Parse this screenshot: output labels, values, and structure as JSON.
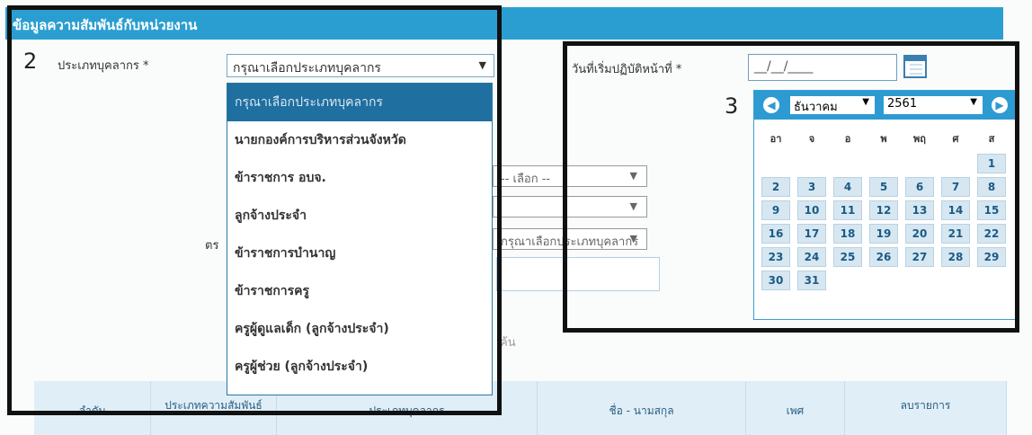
{
  "header": {
    "title": "ข้อมูลความสัมพันธ์กับหน่วยงาน"
  },
  "personnel": {
    "step": "2",
    "label": "ประเภทบุคลากร *",
    "select_value": "กรุณาเลือกประเภทบุคลากร",
    "options": [
      "กรุณาเลือกประเภทบุคลากร",
      "นายกองค์การบริหารส่วนจังหวัด",
      "ข้าราชการ อบจ.",
      "ลูกจ้างประจำ",
      "ข้าราชการบำนาญ",
      "ข้าราชการครู",
      "ครูผู้ดูแลเด็ก (ลูกจ้างประจำ)",
      "ครูผู้ช่วย (ลูกจ้างประจำ)"
    ]
  },
  "start_date": {
    "label": "วันที่เริ่มปฏิบัติหน้าที่ *",
    "placeholder": "__/__/____",
    "step": "3"
  },
  "calendar": {
    "month": "ธันวาคม",
    "year": "2561",
    "weekdays": [
      "อา",
      "จ",
      "อ",
      "พ",
      "พฤ",
      "ศ",
      "ส"
    ],
    "first_weekday_index": 6,
    "days": [
      "1",
      "2",
      "3",
      "4",
      "5",
      "6",
      "7",
      "8",
      "9",
      "10",
      "11",
      "12",
      "13",
      "14",
      "15",
      "16",
      "17",
      "18",
      "19",
      "20",
      "21",
      "22",
      "23",
      "24",
      "25",
      "26",
      "27",
      "28",
      "29",
      "30",
      "31"
    ]
  },
  "background": {
    "select1": "-- เลือก --",
    "select3_text": "กรุณาเลือกประเภทบุคลากร",
    "left_label": "ตร",
    "button_text": "ค้น"
  },
  "table": {
    "headers": [
      "ลำดับ",
      "ประเภทความสัมพันธ์",
      "ประเภทบุคลากร",
      "ชื่อ - นามสกุล",
      "เพศ",
      "ลบรายการ"
    ]
  }
}
